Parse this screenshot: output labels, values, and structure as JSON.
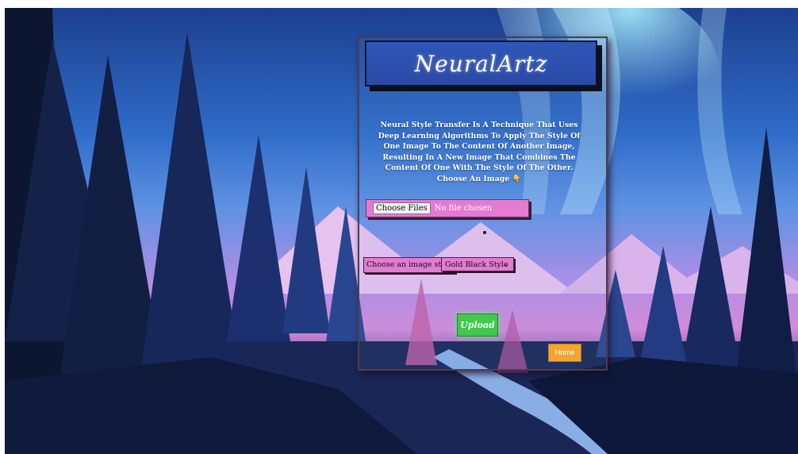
{
  "brand": {
    "title": "NeuralArtz"
  },
  "intro": {
    "text": "Neural Style Transfer Is A Technique That Uses Deep Learning Algorithms To Apply The Style Of One Image To The Content Of Another Image, Resulting In A New Image That Combines The Content Of One With The Style Of The Other. Choose An Image 👇"
  },
  "upload_form": {
    "file_button": "Choose Files",
    "file_status": "No file chosen",
    "style_label": "Choose an image style",
    "style_selected": "Gold Black Style",
    "submit": "Upload"
  },
  "nav": {
    "home": "Home"
  },
  "colors": {
    "brand_bg": "#2f56b8",
    "input_bg": "#e37bd0",
    "upload_bg": "#40c94c",
    "home_bg": "#f3a531"
  },
  "icons": {
    "select_arrow": "chevron-down-icon"
  }
}
